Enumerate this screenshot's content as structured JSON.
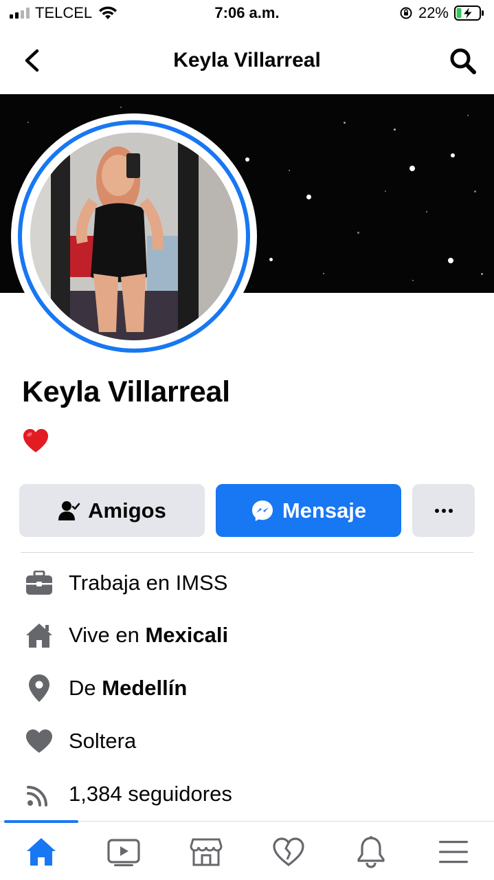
{
  "status_bar": {
    "carrier": "TELCEL",
    "time": "7:06 a.m.",
    "battery_percent": "22%",
    "battery_level": 0.22
  },
  "header": {
    "title": "Keyla Villarreal"
  },
  "profile": {
    "name": "Keyla Villarreal",
    "bio_emoji": "red-heart"
  },
  "actions": {
    "friends_label": "Amigos",
    "message_label": "Mensaje"
  },
  "intro": {
    "work_prefix": "Trabaja en IMSS",
    "lives_prefix": "Vive en ",
    "lives_place": "Mexicali",
    "from_prefix": "De ",
    "from_place": "Medellín",
    "relationship": "Soltera",
    "followers": "1,384 seguidores"
  },
  "bottom_nav": {
    "items": [
      "home-icon",
      "video-icon",
      "marketplace-icon",
      "dating-icon",
      "notifications-icon",
      "menu-icon"
    ],
    "active": "home-icon"
  },
  "colors": {
    "accent": "#1877f2",
    "secondary_button": "#e4e6eb",
    "icon_gray": "#65676b"
  }
}
